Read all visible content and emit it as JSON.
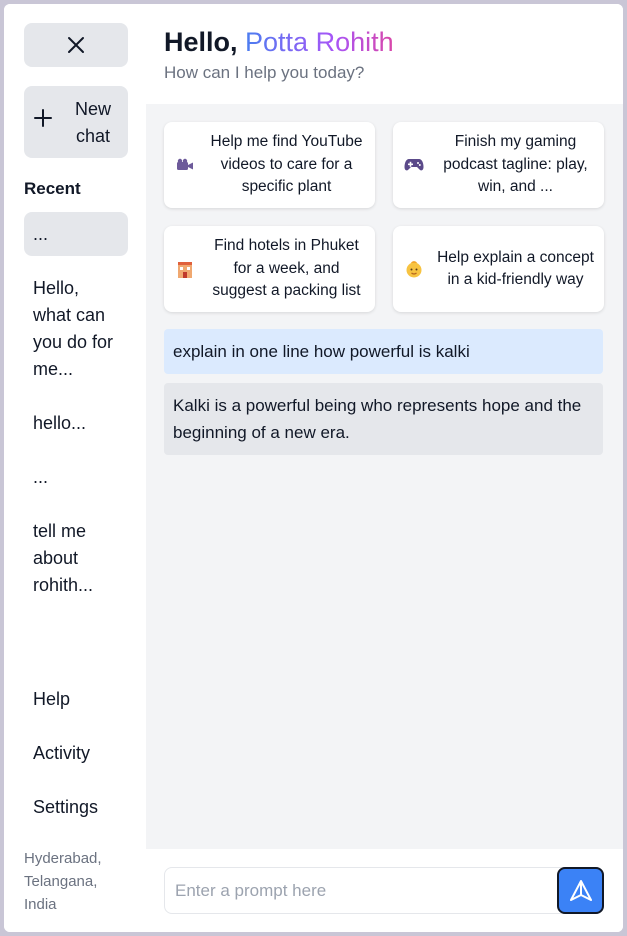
{
  "sidebar": {
    "new_chat_label": "New chat",
    "recent_heading": "Recent",
    "recent_items": [
      {
        "label": "..."
      },
      {
        "label": "Hello, what can you do for me..."
      },
      {
        "label": "hello..."
      },
      {
        "label": "..."
      },
      {
        "label": "tell me about rohith..."
      }
    ],
    "bottom_items": [
      {
        "label": "Help"
      },
      {
        "label": "Activity"
      },
      {
        "label": "Settings"
      }
    ],
    "location": "Hyderabad, Telangana, India"
  },
  "header": {
    "greeting_prefix": "Hello,",
    "user_name": "Potta Rohith",
    "subtitle": "How can I help you today?"
  },
  "suggestions": [
    {
      "icon": "video-camera-icon",
      "text": "Help me find YouTube videos to care for a specific plant"
    },
    {
      "icon": "game-controller-icon",
      "text": "Finish my gaming podcast tagline: play, win, and ..."
    },
    {
      "icon": "hotel-icon",
      "text": "Find hotels in Phuket for a week, and suggest a packing list"
    },
    {
      "icon": "baby-icon",
      "text": "Help explain a concept in a kid-friendly way"
    }
  ],
  "conversation": {
    "user_message": "explain in one line how powerful is kalki",
    "bot_message": "Kalki is a powerful being who represents hope and the beginning of a new era."
  },
  "input": {
    "placeholder": "Enter a prompt here",
    "value": ""
  },
  "colors": {
    "accent": "#3b82f6",
    "user_bubble": "#dbeafe",
    "bot_bubble": "#e5e7eb",
    "name_gradient": [
      "#4b7df0",
      "#a855f7",
      "#d946a8"
    ]
  }
}
